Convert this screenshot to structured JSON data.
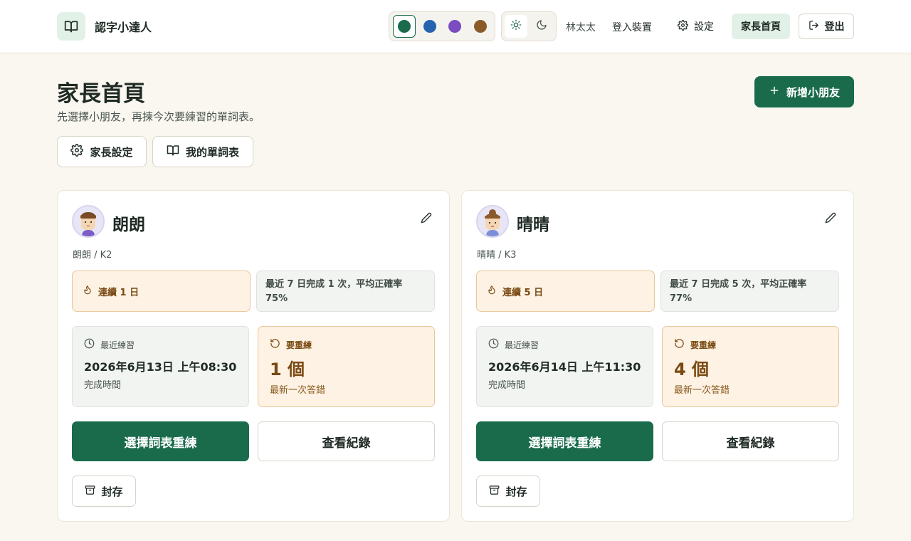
{
  "app": {
    "title": "認字小達人"
  },
  "header": {
    "theme_swatches": [
      {
        "name": "green",
        "color": "#1a6b4c",
        "selected": true
      },
      {
        "name": "blue",
        "color": "#2563b0",
        "selected": false
      },
      {
        "name": "purple",
        "color": "#7a4cc0",
        "selected": false
      },
      {
        "name": "brown",
        "color": "#8b5a2b",
        "selected": false
      }
    ],
    "modes": [
      {
        "name": "light",
        "icon": "sun-icon",
        "selected": true
      },
      {
        "name": "dark",
        "icon": "moon-icon",
        "selected": false
      }
    ],
    "user_name": "林太太",
    "login_device": "登入裝置",
    "settings": "設定",
    "parent_home": "家長首頁",
    "logout": "登出"
  },
  "page": {
    "title": "家長首頁",
    "subtitle": "先選擇小朋友，再揀今次要練習的單詞表。",
    "add_kid": "新增小朋友",
    "parent_settings": "家長設定",
    "my_wordlists": "我的單詞表"
  },
  "colors": {
    "accent": "#1a6b4c",
    "accent_soft": "#e2f1e8",
    "warning_bg": "#fdf2e3",
    "warning_text": "#7a4a14",
    "page_bg": "#faf7f0"
  },
  "kids": [
    {
      "name": "朗朗",
      "meta": "朗朗 / K2",
      "streak": "連續 1 日",
      "recent": "最近 7 日完成 1 次，平均正確率 75%",
      "last_label": "最近練習",
      "last_value": "2026年6月13日 上午08:30",
      "last_note": "完成時間",
      "retry_label": "要重練",
      "retry_value": "1 個",
      "retry_note": "最新一次答錯",
      "primary": "選擇詞表重練",
      "secondary": "查看紀錄",
      "archive": "封存"
    },
    {
      "name": "晴晴",
      "meta": "晴晴 / K3",
      "streak": "連續 5 日",
      "recent": "最近 7 日完成 5 次，平均正確率 77%",
      "last_label": "最近練習",
      "last_value": "2026年6月14日 上午11:30",
      "last_note": "完成時間",
      "retry_label": "要重練",
      "retry_value": "4 個",
      "retry_note": "最新一次答錯",
      "primary": "選擇詞表重練",
      "secondary": "查看紀錄",
      "archive": "封存"
    }
  ]
}
